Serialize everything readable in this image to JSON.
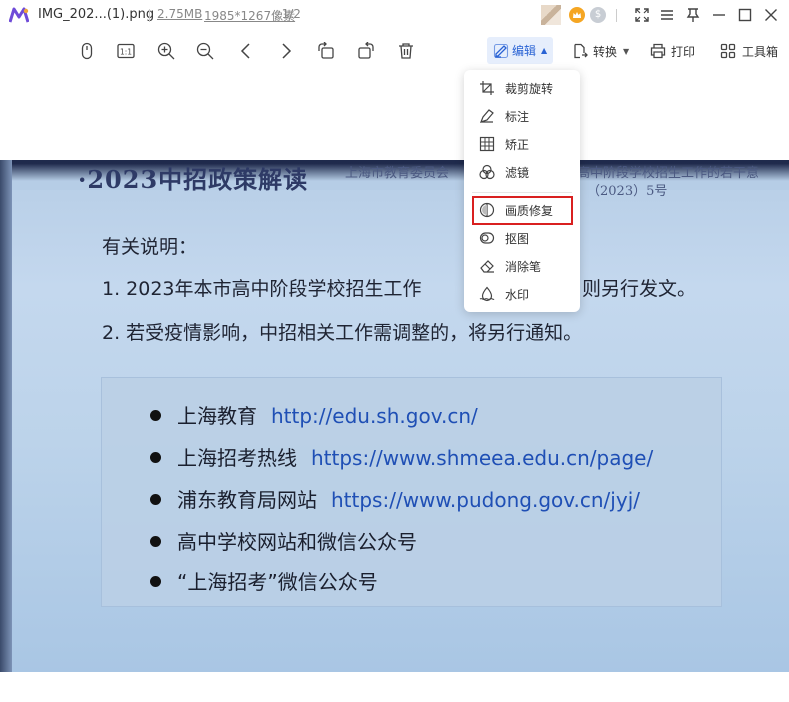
{
  "titlebar": {
    "filename": "IMG_202...(1).png",
    "size": "2.75MB",
    "dimensions": "1985*1267像素",
    "page": ", 1/2",
    "badge_a": "",
    "badge_b": "$"
  },
  "toolbar": {
    "edit_label": "编辑",
    "convert_label": "转换",
    "print_label": "打印",
    "toolbox_label": "工具箱",
    "ratio_label": "1:1"
  },
  "edit_menu": {
    "items": [
      {
        "label": "裁剪旋转",
        "icon": "crop-icon"
      },
      {
        "label": "标注",
        "icon": "annotate-icon"
      },
      {
        "label": "矫正",
        "icon": "correct-icon"
      },
      {
        "label": "滤镜",
        "icon": "filter-icon"
      },
      {
        "label": "画质修复",
        "icon": "quality-repair-icon"
      },
      {
        "label": "抠图",
        "icon": "cutout-icon"
      },
      {
        "label": "消除笔",
        "icon": "eraser-icon"
      },
      {
        "label": "水印",
        "icon": "watermark-icon"
      }
    ]
  },
  "photo": {
    "title": "·2023中招政策解读",
    "sub1": "上海市教育委员会",
    "sub2": "高中阶段学校招生工作的若干意",
    "sub3": "（2023）5号",
    "note_head": "有关说明：",
    "note1": "1. 2023年本市高中阶段学校招生工作",
    "note1_tail": "则另行发文。",
    "note2": "2. 若受疫情影响，中招相关工作需调整的，将另行通知。",
    "links": [
      {
        "name": "上海教育",
        "url": "http://edu.sh.gov.cn/"
      },
      {
        "name": "上海招考热线",
        "url": "https://www.shmeea.edu.cn/page/"
      },
      {
        "name": "浦东教育局网站",
        "url": "https://www.pudong.gov.cn/jyj/"
      },
      {
        "name": "高中学校网站和微信公众号",
        "url": ""
      },
      {
        "name": "“上海招考”微信公众号",
        "url": ""
      }
    ]
  },
  "colors": {
    "accent": "#2a63d4",
    "highlight_border": "#d92020"
  }
}
